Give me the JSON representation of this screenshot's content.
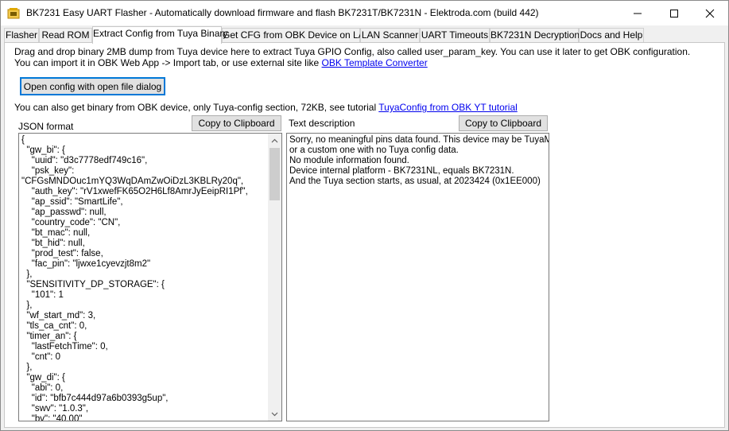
{
  "window": {
    "title": "BK7231 Easy UART Flasher - Automatically download firmware and flash BK7231T/BK7231N  - Elektroda.com (build 442)"
  },
  "tabs": [
    {
      "label": "Flasher"
    },
    {
      "label": "Read ROM"
    },
    {
      "label": "Extract Config from Tuya Binary"
    },
    {
      "label": "Get CFG from OBK Device on LAN"
    },
    {
      "label": "LAN Scanner"
    },
    {
      "label": "UART Timeouts"
    },
    {
      "label": "BK7231N Decryption"
    },
    {
      "label": "Docs and Help"
    }
  ],
  "instructions": {
    "line1": "Drag and drop binary 2MB dump from Tuya device here to extract  Tuya GPIO Config, also called user_param_key. You can use it later to get OBK configuration.",
    "line2_prefix": "You can import it in OBK Web App -> Import tab, or use external site like ",
    "line2_link": "OBK Template Converter",
    "open_button": "Open config with open file dialog",
    "line3_prefix": "You can also get binary from OBK device, only Tuya-config section, 72KB, see tutorial ",
    "line3_link": "TuyaConfig from OBK YT tutorial"
  },
  "json_panel": {
    "label": "JSON format",
    "copy_button": "Copy to Clipboard",
    "content": "{\n  \"gw_bi\": {\n    \"uuid\": \"d3c7778edf749c16\",\n    \"psk_key\":\n\"CFGsMNDOuc1mYQ3WqDAmZwOiDzL3KBLRy20q\",\n    \"auth_key\": \"rV1xwefFK65O2H6Lf8AmrJyEeipRI1Pf\",\n    \"ap_ssid\": \"SmartLife\",\n    \"ap_passwd\": null,\n    \"country_code\": \"CN\",\n    \"bt_mac\": null,\n    \"bt_hid\": null,\n    \"prod_test\": false,\n    \"fac_pin\": \"ljwxe1cyevzjt8m2\"\n  },\n  \"SENSITIVITY_DP_STORAGE\": {\n    \"101\": 1\n  },\n  \"wf_start_md\": 3,\n  \"tls_ca_cnt\": 0,\n  \"timer_an\": {\n    \"lastFetchTime\": 0,\n    \"cnt\": 0\n  },\n  \"gw_di\": {\n    \"abi\": 0,\n    \"id\": \"bfb7c444d97a6b0393g5up\",\n    \"swv\": \"1.0.3\",\n    \"bv\": \"40.00\""
  },
  "text_panel": {
    "label": "Text description",
    "copy_button": "Copy to Clipboard",
    "content": "Sorry, no meaningful pins data found. This device may be TuyaMCU\nor a custom one with no Tuya config data.\nNo module information found.\nDevice internal platform - BK7231NL, equals BK7231N.\nAnd the Tuya section starts, as usual, at 2023424 (0x1EE000)"
  },
  "colors": {
    "link": "#0000ee",
    "focus_border": "#0078d7",
    "tab_page_bg": "#ffffff",
    "chrome_bg": "#f0f0f0"
  }
}
